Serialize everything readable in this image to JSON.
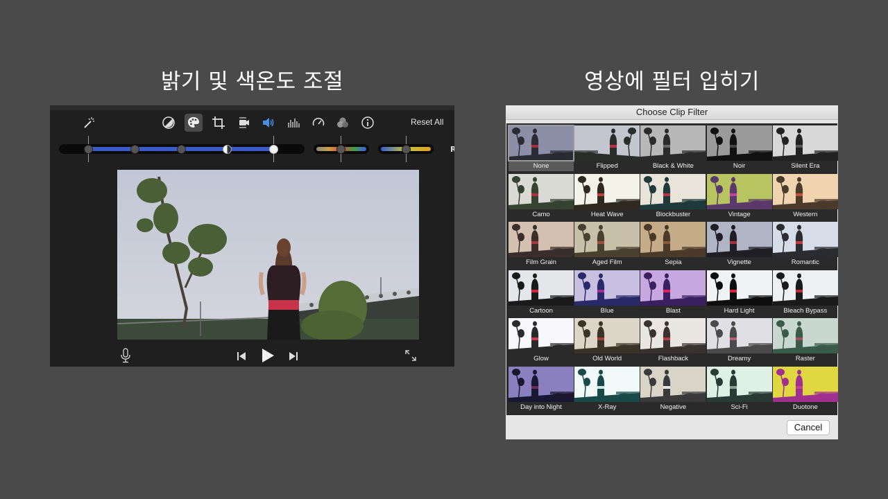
{
  "headings": {
    "left": "밝기 및 색온도 조절",
    "right": "영상에 필터 입히기"
  },
  "editor": {
    "toolbar_icons": [
      "magic-wand-icon",
      "color-balance-icon",
      "color-correction-icon",
      "crop-icon",
      "stabilization-icon",
      "volume-icon",
      "equalizer-icon",
      "speed-icon",
      "clip-filter-icon",
      "info-icon"
    ],
    "reset_label": "Reset All",
    "cut_label": "R",
    "colors": {
      "exposure_fill": "#3a5cc8",
      "accent_volume": "#4a8fe6"
    },
    "playback_icons": [
      "microphone-icon",
      "skip-back-icon",
      "play-icon",
      "skip-forward-icon",
      "fullscreen-icon"
    ]
  },
  "dialog": {
    "title": "Choose Clip Filter",
    "selected": "None",
    "filters": [
      "None",
      "Flipped",
      "Black & White",
      "Noir",
      "Silent Era",
      "Camo",
      "Heat Wave",
      "Blockbuster",
      "Vintage",
      "Western",
      "Film Grain",
      "Aged Film",
      "Sepia",
      "Vignette",
      "Romantic",
      "Cartoon",
      "Blue",
      "Blast",
      "Hard Light",
      "Bleach Bypass",
      "Glow",
      "Old World",
      "Flashback",
      "Dreamy",
      "Raster",
      "Day into Night",
      "X-Ray",
      "Negative",
      "Sci-Fi",
      "Duotone"
    ],
    "cancel_label": "Cancel"
  }
}
